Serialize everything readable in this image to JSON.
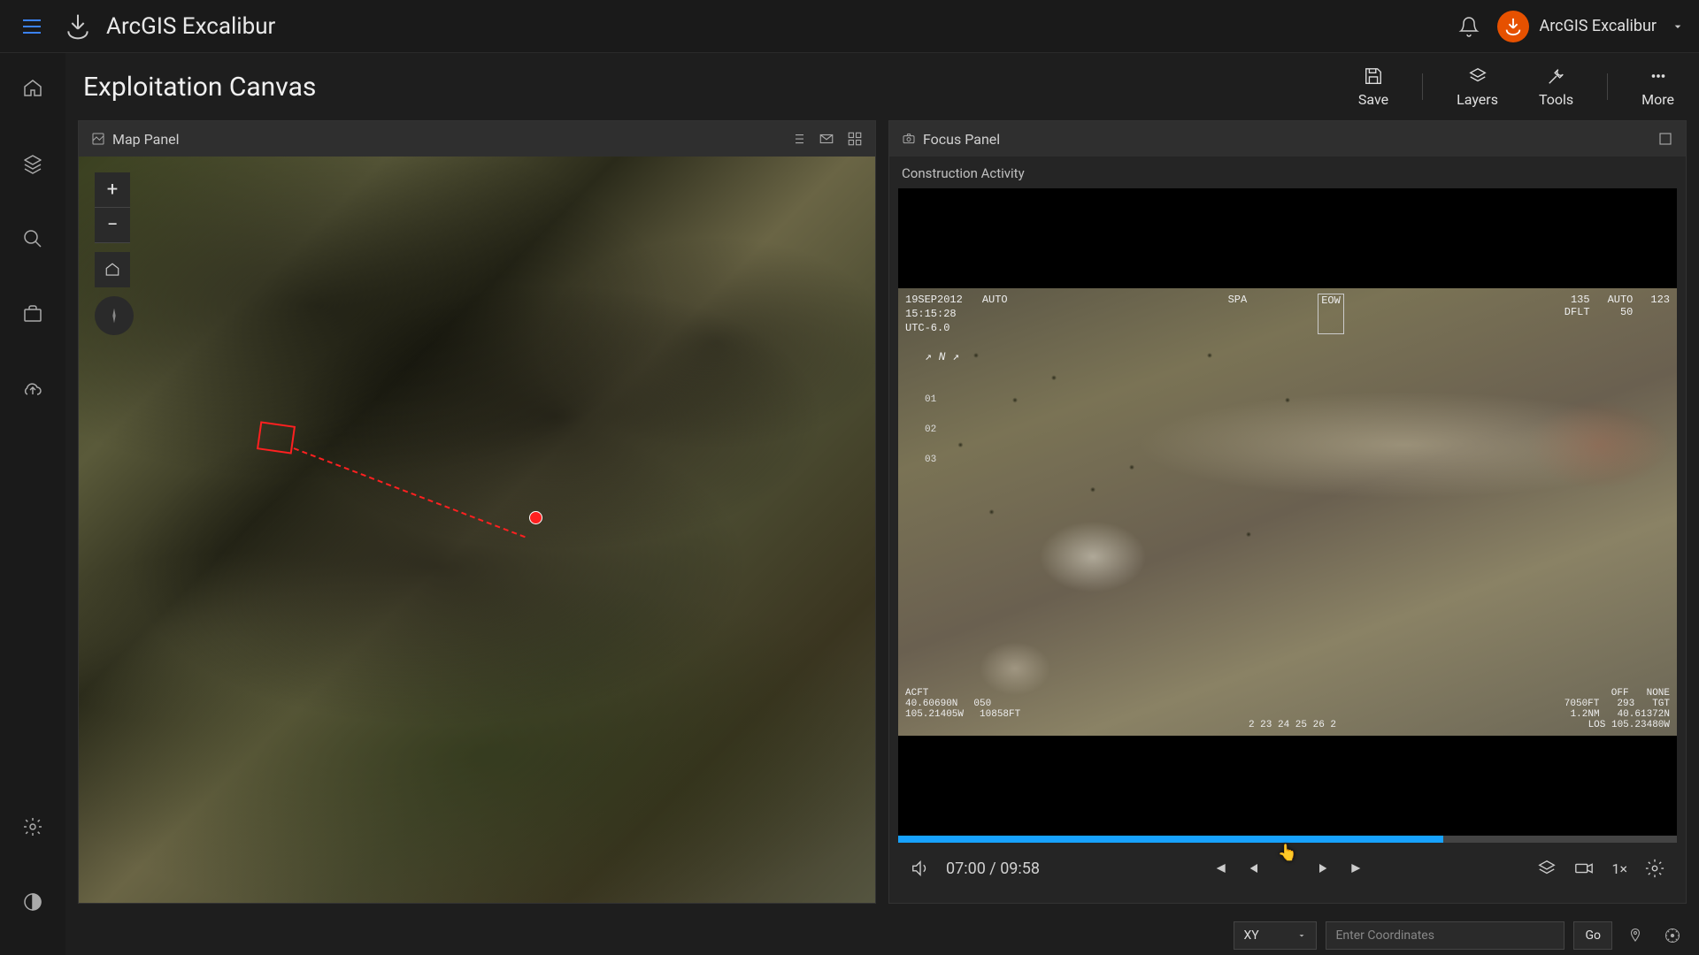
{
  "app": {
    "title": "ArcGIS Excalibur",
    "user": "ArcGIS Excalibur"
  },
  "page": {
    "title": "Exploitation Canvas"
  },
  "actions": {
    "save": "Save",
    "layers": "Layers",
    "tools": "Tools",
    "more": "More"
  },
  "mapPanel": {
    "title": "Map Panel"
  },
  "focusPanel": {
    "title": "Focus Panel",
    "subtitle": "Construction Activity",
    "overlay": {
      "date": "19SEP2012",
      "time": "15:15:28",
      "tz": "UTC-6.0",
      "auto": "AUTO",
      "spa": "SPA",
      "eow": "EOW",
      "hdg": "135",
      "dflt": "DFLT",
      "auto2": "AUTO",
      "v50": "50",
      "v123": "123",
      "acft": "ACFT",
      "lat": "40.60690N",
      "lon": "105.21405W",
      "v050": "050",
      "alt1": "10858FT",
      "ticks": "2  23  24  25  26  2",
      "alt2": "7050FT",
      "rng1": "293",
      "rng2": "1.2NM",
      "off": "OFF",
      "none": "NONE",
      "tgt": "TGT",
      "tgtLat": "40.61372N",
      "los": "LOS 105.23480W",
      "north": "N",
      "t01": "01",
      "t02": "02",
      "t03": "03"
    },
    "progressPercent": 70,
    "time": {
      "current": "07:00",
      "total": "09:58"
    },
    "speed": "1×"
  },
  "footer": {
    "coordType": "XY",
    "placeholder": "Enter Coordinates",
    "go": "Go"
  }
}
